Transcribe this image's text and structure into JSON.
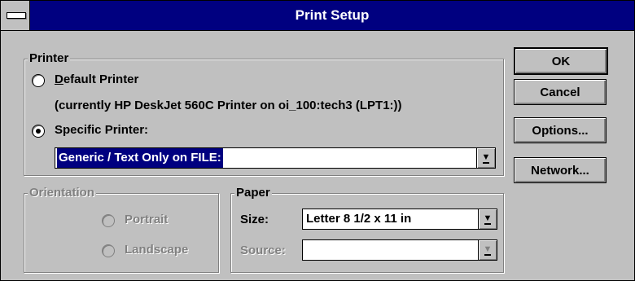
{
  "window": {
    "title": "Print Setup"
  },
  "printer": {
    "group_label": "Printer",
    "default_label": "Default Printer",
    "current_printer_text": "(currently HP DeskJet 560C Printer on oi_100:tech3 (LPT1:))",
    "specific_label": "Specific Printer:",
    "specific_value": "Generic / Text Only on FILE:",
    "selected": "specific"
  },
  "orientation": {
    "group_label": "Orientation",
    "portrait_label": "Portrait",
    "landscape_label": "Landscape",
    "enabled": false
  },
  "paper": {
    "group_label": "Paper",
    "size_label": "Size:",
    "size_value": "Letter 8 1/2 x 11 in",
    "source_label": "Source:",
    "source_value": "",
    "source_enabled": false
  },
  "buttons": {
    "ok": "OK",
    "cancel": "Cancel",
    "options": "Options...",
    "network": "Network..."
  },
  "icons": {
    "system_menu": "system-menu-icon",
    "dropdown": "dropdown-arrow-icon"
  }
}
